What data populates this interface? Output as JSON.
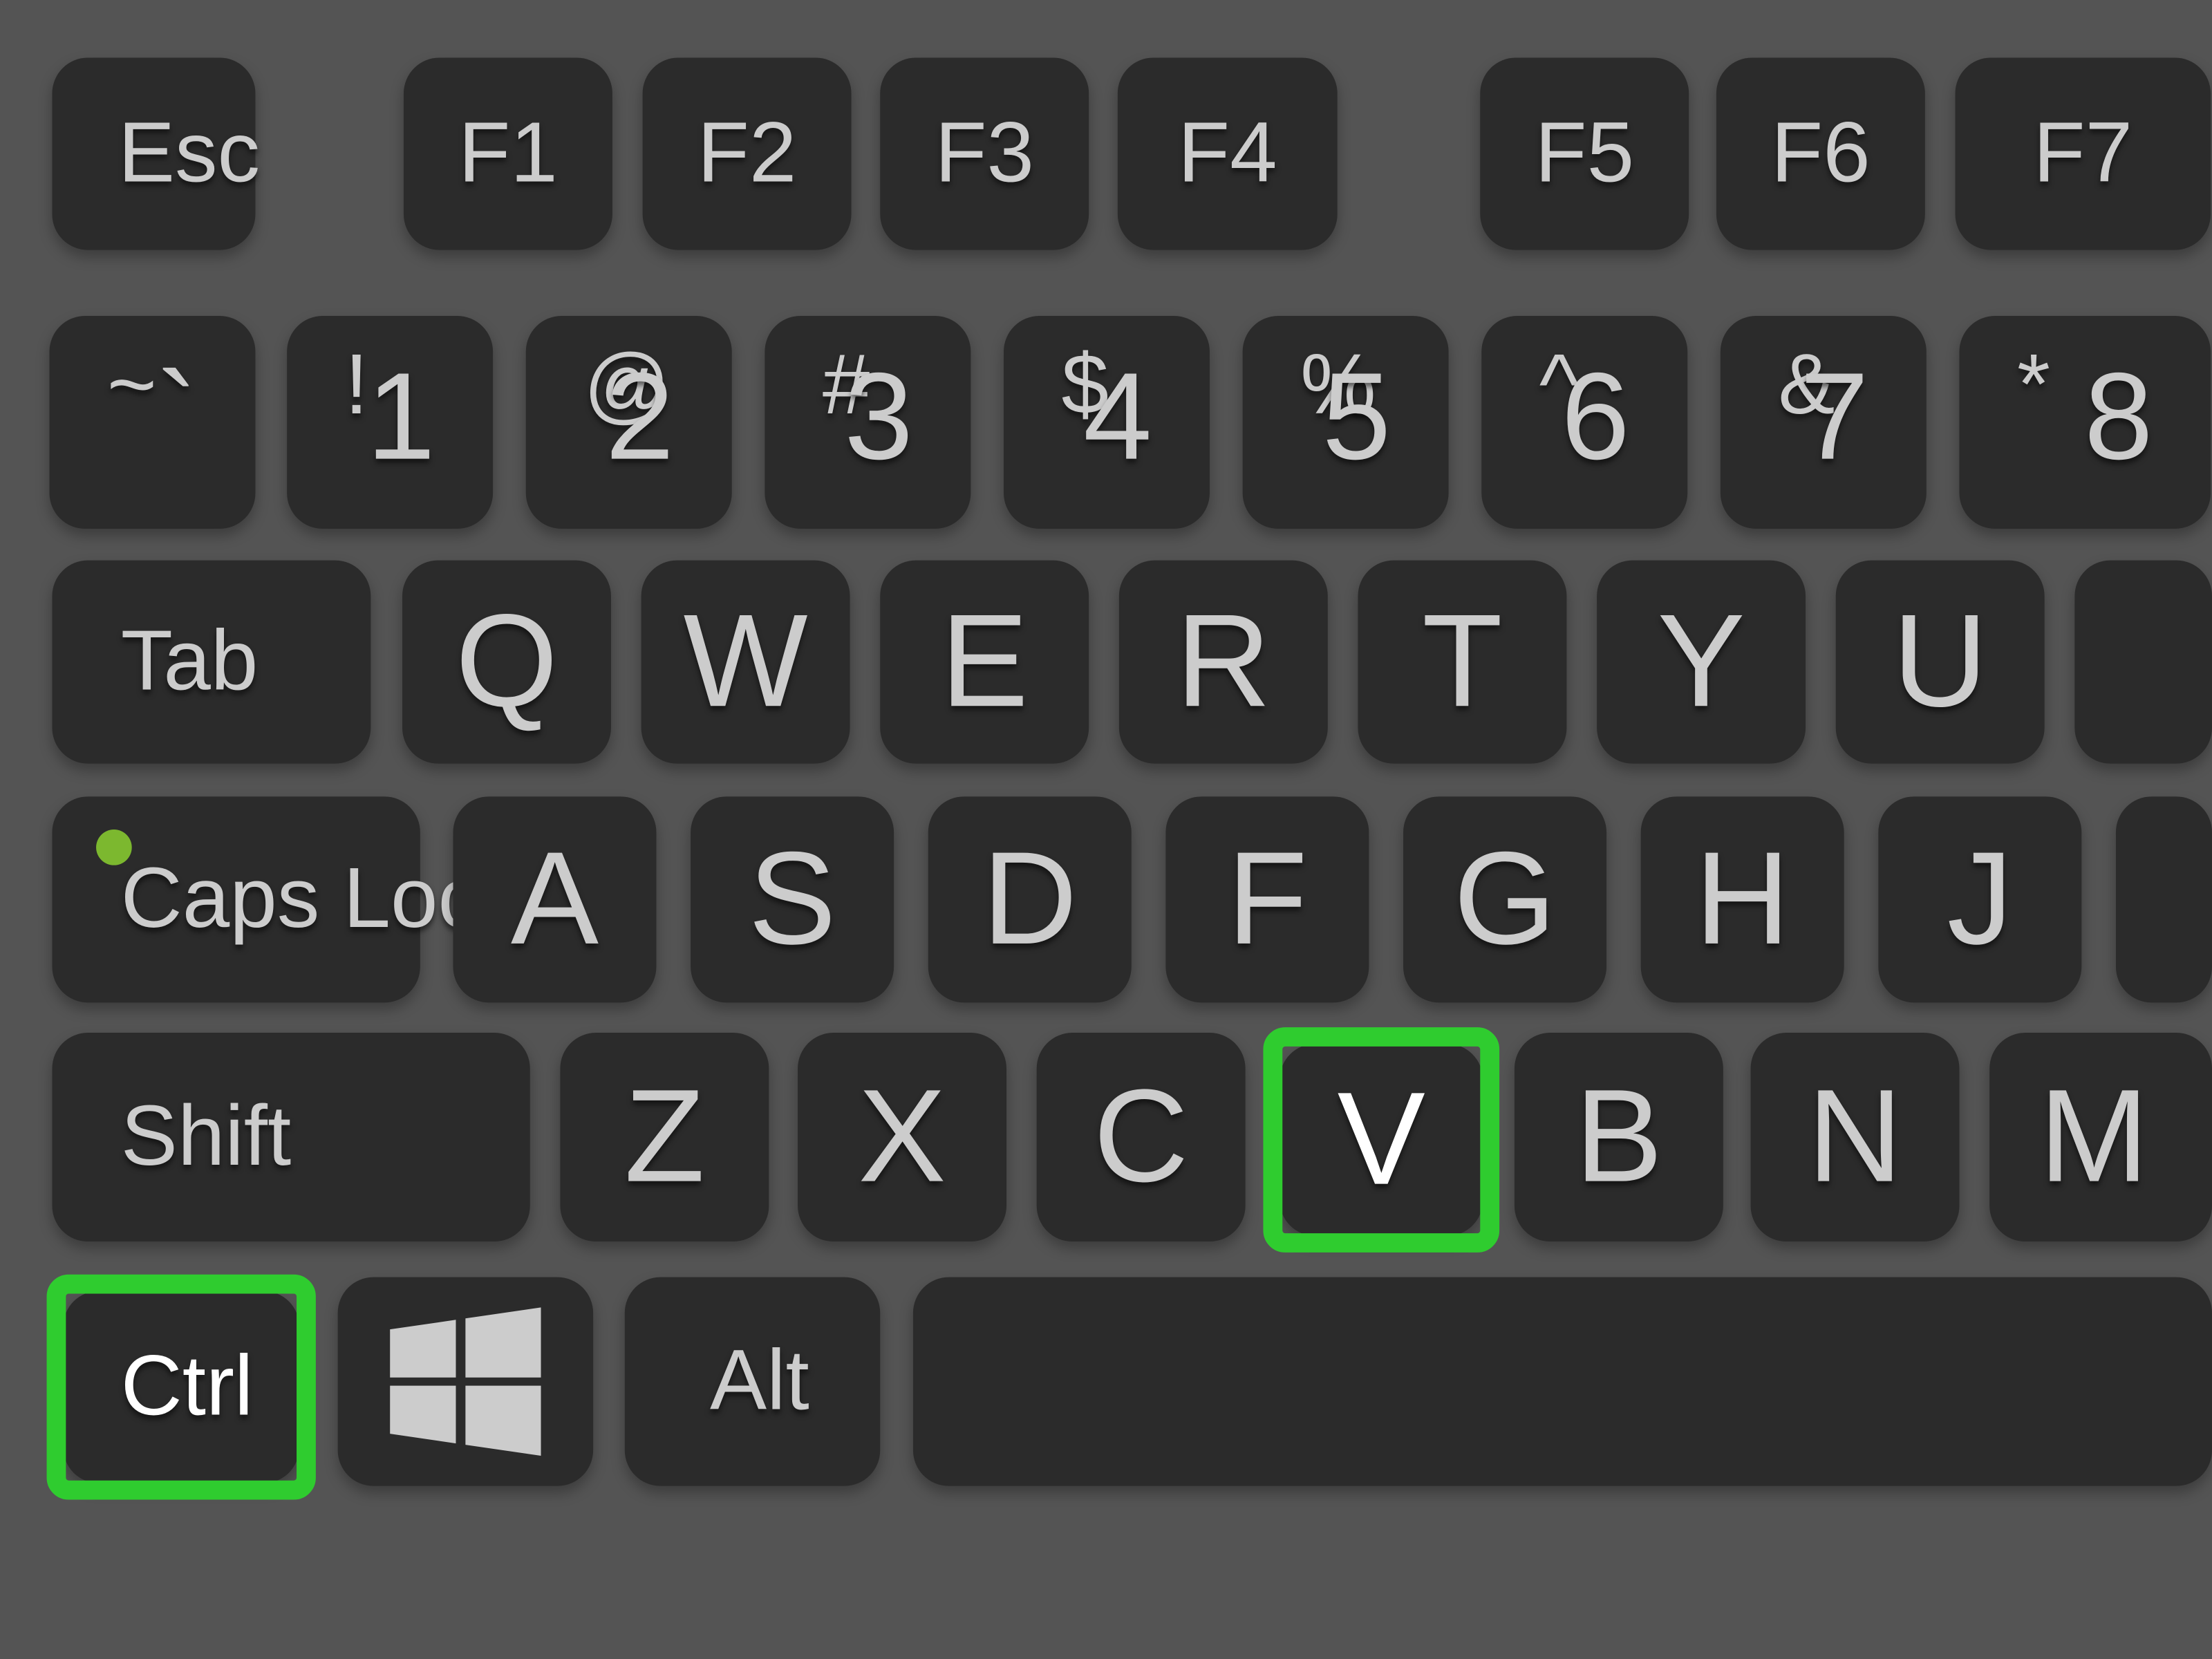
{
  "meta": {
    "subject": "laptop-keyboard",
    "shortcut": "Ctrl + V",
    "background_color": "#545454",
    "key_color": "#2b2b2b",
    "key_text_color": "#cccccc",
    "highlight_color": "#2fcc2f",
    "caps_lock_led_color": "#7cb82f"
  },
  "highlighted_keys": [
    "Ctrl",
    "V"
  ],
  "rows": {
    "function_row": [
      {
        "id": "esc",
        "label": "Esc"
      },
      {
        "id": "f1",
        "label": "F1"
      },
      {
        "id": "f2",
        "label": "F2"
      },
      {
        "id": "f3",
        "label": "F3"
      },
      {
        "id": "f4",
        "label": "F4"
      },
      {
        "id": "f5",
        "label": "F5"
      },
      {
        "id": "f6",
        "label": "F6"
      },
      {
        "id": "f7",
        "label": "F7"
      }
    ],
    "number_row": [
      {
        "id": "backtick",
        "shift": "~",
        "base": "`"
      },
      {
        "id": "one",
        "shift": "!",
        "base": "1"
      },
      {
        "id": "two",
        "shift": "@",
        "base": "2"
      },
      {
        "id": "three",
        "shift": "#",
        "base": "3"
      },
      {
        "id": "four",
        "shift": "$",
        "base": "4"
      },
      {
        "id": "five",
        "shift": "%",
        "base": "5"
      },
      {
        "id": "six",
        "shift": "^",
        "base": "6"
      },
      {
        "id": "seven",
        "shift": "&",
        "base": "7"
      },
      {
        "id": "eight",
        "shift": "*",
        "base": "8"
      }
    ],
    "top_row": [
      {
        "id": "tab",
        "label": "Tab"
      },
      {
        "id": "q",
        "label": "Q"
      },
      {
        "id": "w",
        "label": "W"
      },
      {
        "id": "e",
        "label": "E"
      },
      {
        "id": "r",
        "label": "R"
      },
      {
        "id": "t",
        "label": "T"
      },
      {
        "id": "y",
        "label": "Y"
      },
      {
        "id": "u",
        "label": "U"
      }
    ],
    "home_row": [
      {
        "id": "capslock",
        "label": "Caps Lock"
      },
      {
        "id": "a",
        "label": "A"
      },
      {
        "id": "s",
        "label": "S"
      },
      {
        "id": "d",
        "label": "D"
      },
      {
        "id": "f",
        "label": "F"
      },
      {
        "id": "g",
        "label": "G"
      },
      {
        "id": "h",
        "label": "H"
      },
      {
        "id": "j",
        "label": "J"
      }
    ],
    "bottom_letter_row": [
      {
        "id": "shift",
        "label": "Shift"
      },
      {
        "id": "z",
        "label": "Z"
      },
      {
        "id": "x",
        "label": "X"
      },
      {
        "id": "c",
        "label": "C"
      },
      {
        "id": "v",
        "label": "V"
      },
      {
        "id": "b",
        "label": "B"
      },
      {
        "id": "n",
        "label": "N"
      },
      {
        "id": "m",
        "label": "M"
      }
    ],
    "modifier_row": [
      {
        "id": "ctrl",
        "label": "Ctrl"
      },
      {
        "id": "win",
        "label": ""
      },
      {
        "id": "alt",
        "label": "Alt"
      },
      {
        "id": "space",
        "label": ""
      }
    ]
  }
}
